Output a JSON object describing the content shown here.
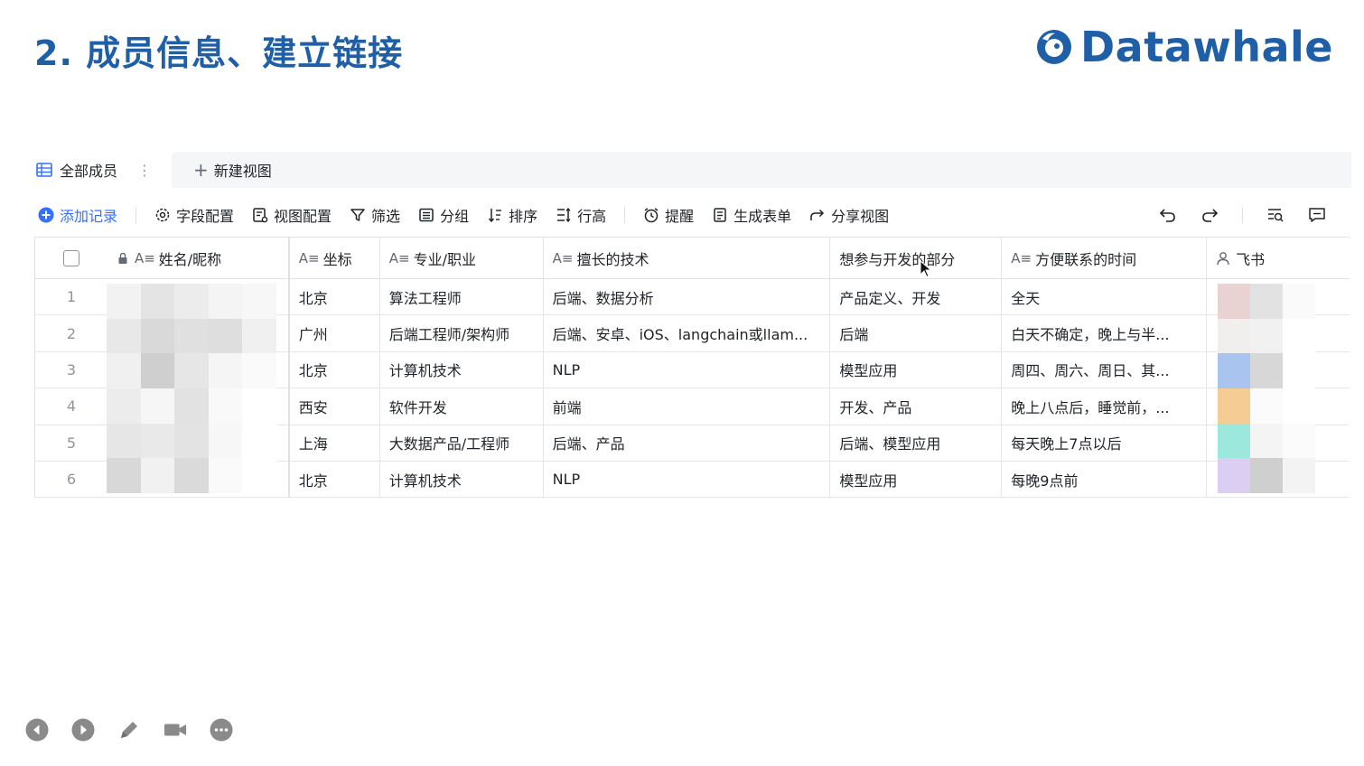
{
  "slide": {
    "title": "2. 成员信息、建立链接"
  },
  "logo": {
    "text": "Datawhale",
    "color": "#1f5fa8"
  },
  "views": {
    "active_view": "全部成员",
    "new_view": "新建视图"
  },
  "toolbar": {
    "add_record": "添加记录",
    "field_config": "字段配置",
    "view_config": "视图配置",
    "filter": "筛选",
    "group": "分组",
    "sort": "排序",
    "row_height": "行高",
    "reminder": "提醒",
    "generate_form": "生成表单",
    "share_view": "分享视图",
    "accent_color": "#3370ff"
  },
  "table": {
    "columns": [
      "姓名/昵称",
      "坐标",
      "专业/职业",
      "擅长的技术",
      "想参与开发的部分",
      "方便联系的时间",
      "飞书"
    ],
    "rows": [
      {
        "index": "1",
        "location": "北京",
        "job": "算法工程师",
        "tech": "后端、数据分析",
        "part": "产品定义、开发",
        "time": "全天"
      },
      {
        "index": "2",
        "location": "广州",
        "job": "后端工程师/架构师",
        "tech": "后端、安卓、iOS、langchain或llam...",
        "part": "后端",
        "time": "白天不确定，晚上与半..."
      },
      {
        "index": "3",
        "location": "北京",
        "job": "计算机技术",
        "tech": "NLP",
        "part": "模型应用",
        "time": "周四、周六、周日、其..."
      },
      {
        "index": "4",
        "location": "西安",
        "job": "软件开发",
        "tech": "前端",
        "part": "开发、产品",
        "time": "晚上八点后，睡觉前，..."
      },
      {
        "index": "5",
        "location": "上海",
        "job": "大数据产品/工程师",
        "tech": "后端、产品",
        "part": "后端、模型应用",
        "time": "每天晚上7点以后"
      },
      {
        "index": "6",
        "location": "北京",
        "job": "计算机技术",
        "tech": "NLP",
        "part": "模型应用",
        "time": "每晚9点前"
      }
    ]
  },
  "icons": {
    "player": [
      "prev-icon",
      "play-icon",
      "pen-icon",
      "camera-icon",
      "more-icon"
    ]
  }
}
